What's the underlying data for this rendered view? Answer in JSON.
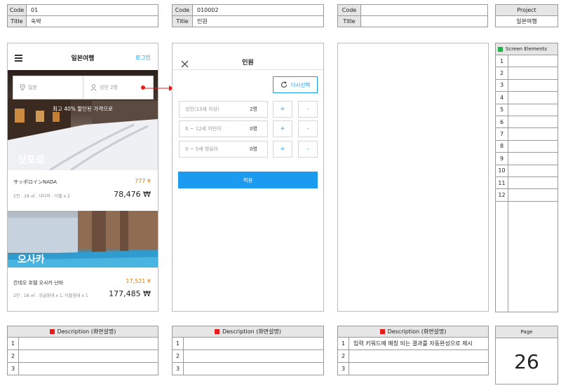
{
  "header": {
    "code_label": "Code",
    "title_label": "Title",
    "screens": [
      {
        "code": "01",
        "title": "숙박"
      },
      {
        "code": "010002",
        "title": "인원"
      },
      {
        "code": "",
        "title": ""
      }
    ],
    "project_label": "Project",
    "project_value": "일본여행"
  },
  "screen_elements": {
    "label": "Screen Elements",
    "rows": [
      "1",
      "2",
      "3",
      "4",
      "5",
      "6",
      "7",
      "8",
      "9",
      "10",
      "11",
      "12"
    ]
  },
  "descriptions": {
    "label": "Description (화면설명)",
    "row_nums": [
      "1",
      "2",
      "3"
    ],
    "texts3": [
      "입력 키워드에 매칭 되는 결과를 자동완성으로 제시",
      "",
      ""
    ]
  },
  "page": {
    "label": "Page",
    "number": "26"
  },
  "screen1": {
    "app_title": "일본여행",
    "login": "로그인",
    "location": "일본",
    "guests": "성인 2명",
    "promo": "최고 40% 할인된 가격으로",
    "card1": {
      "city": "삿포로",
      "name": "サッポロインNADA",
      "yen": "777 ¥",
      "detail": "2인 . 18 ㎡ . 다다미 : 이불 x 2",
      "price": "78,476 ₩"
    },
    "card2": {
      "city": "오사카",
      "name": "칸데오 호텔 오사카 난바",
      "yen": "17,521 ¥",
      "detail": "2인 . 18 ㎡ . 싱글침대 x 1, 더블침대 x 1",
      "price": "177,485 ₩"
    }
  },
  "screen2": {
    "title": "인원",
    "reset": "다시선택",
    "rows": [
      {
        "label": "성인(13세 이상)",
        "count": "2명"
      },
      {
        "label": "6 ~ 12세 어린이",
        "count": "0명"
      },
      {
        "label": "0 ~ 5세 영유아",
        "count": "0명"
      }
    ],
    "plus": "+",
    "minus": "-",
    "apply": "적용"
  },
  "colors": {
    "accent": "#1a9bf0",
    "yen": "#e07a00",
    "red": "#e81b1b",
    "green": "#22b24c"
  }
}
